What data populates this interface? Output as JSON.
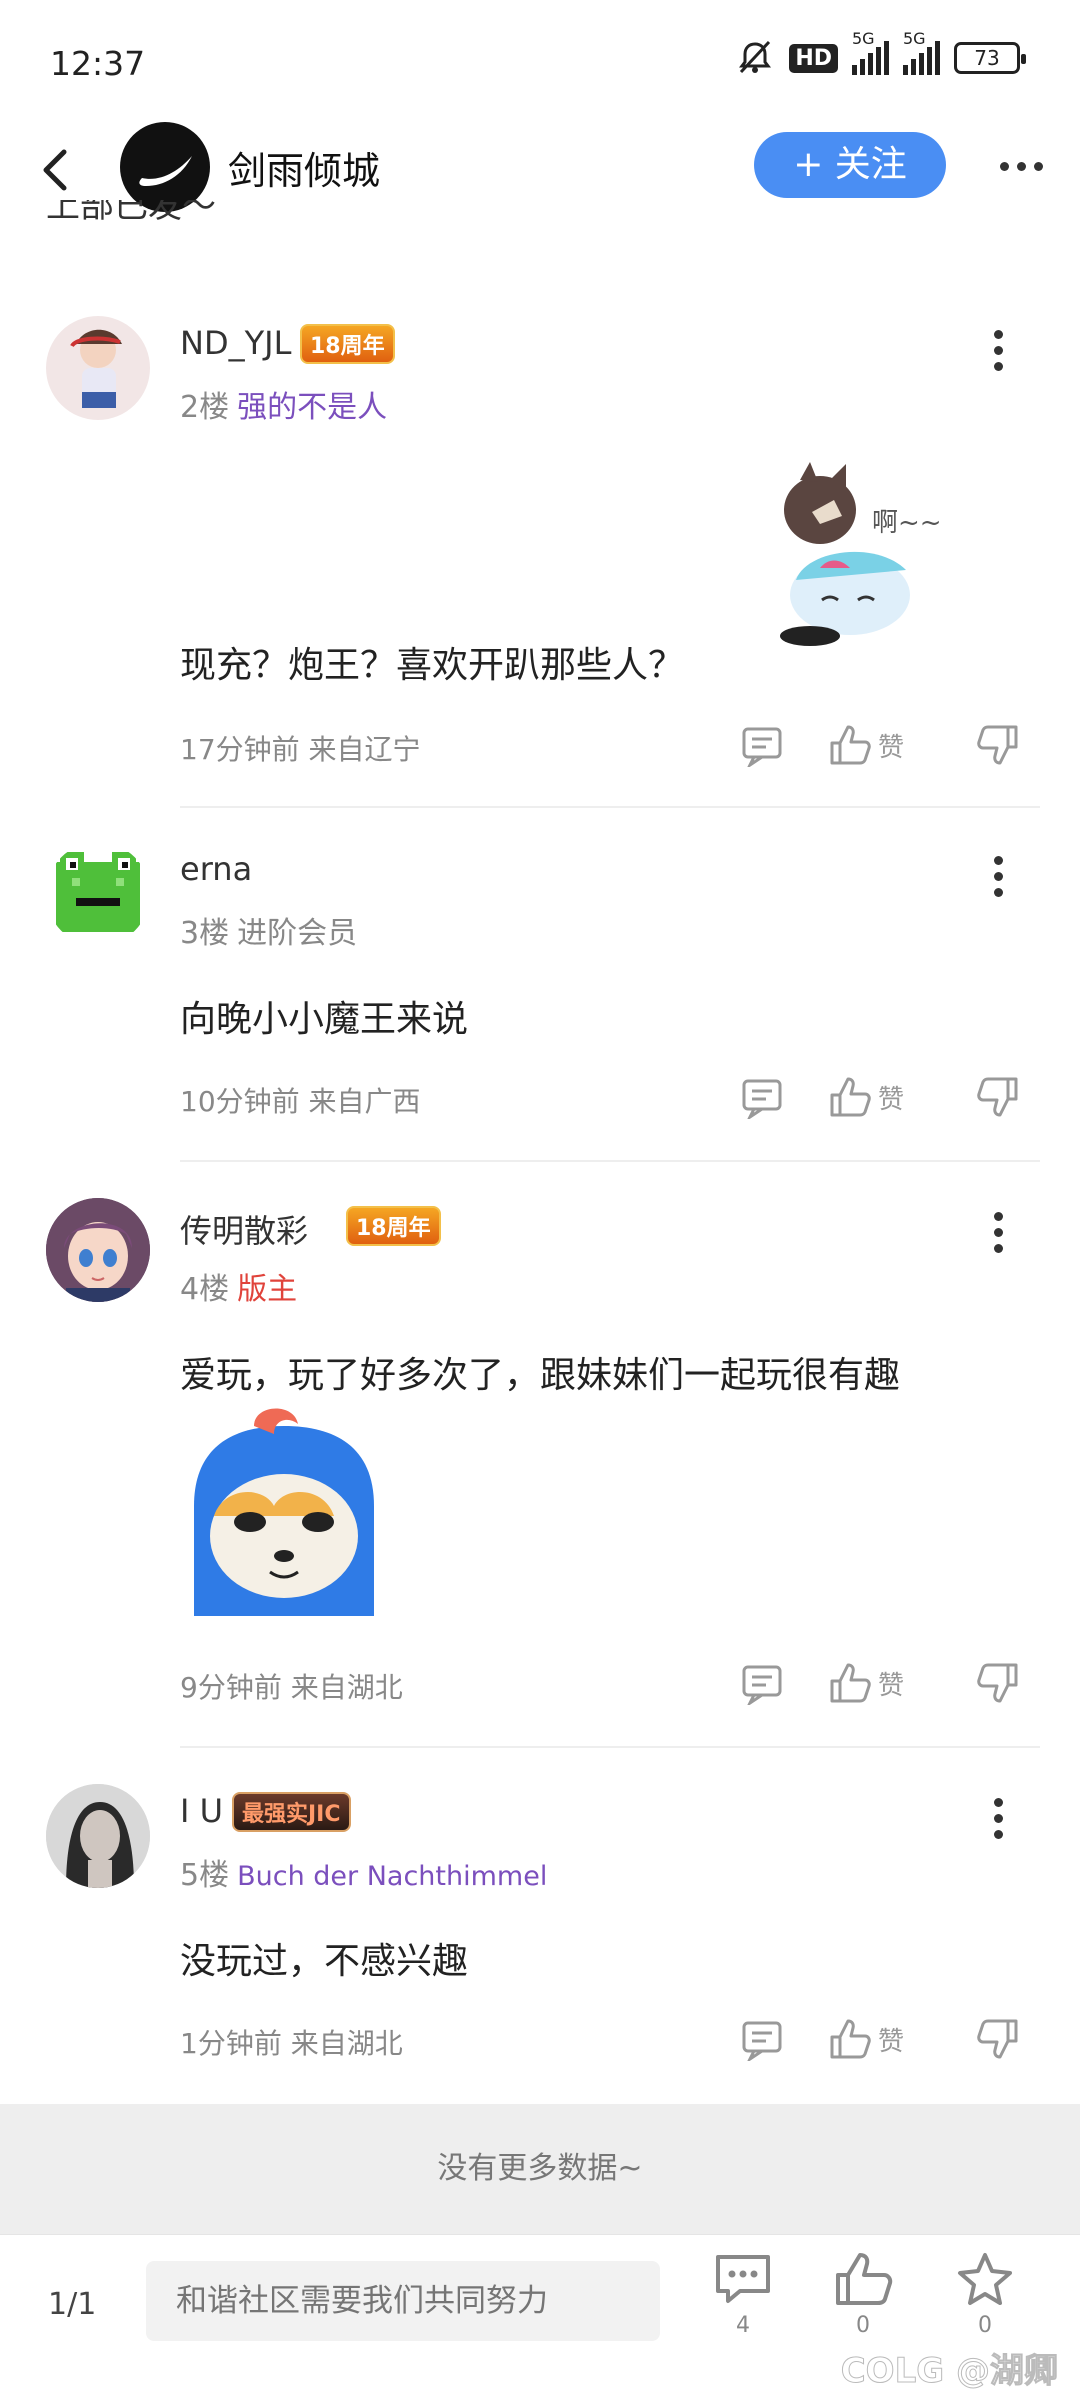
{
  "status": {
    "time": "12:37",
    "network1": "5G",
    "network2": "5G",
    "battery": "73",
    "hd": "HD"
  },
  "header": {
    "title": "剑雨倾城",
    "follow_label": "+ 关注",
    "cut_text": "上部已发～"
  },
  "comments": [
    {
      "user": "ND_YJL",
      "badge": "18周年",
      "floor": "2楼",
      "role": "强的不是人",
      "role_color": "#7b4fbd",
      "text": "现充？炮王？喜欢开趴那些人？",
      "time": "17分钟前 来自辽宁",
      "sticker_text": "啊~~",
      "like": "赞"
    },
    {
      "user": "erna",
      "badge": "",
      "floor": "3楼",
      "role": "进阶会员",
      "role_color": "#888888",
      "text": "向晚小小魔王来说",
      "time": "10分钟前 来自广西",
      "like": "赞"
    },
    {
      "user": "传明散彩",
      "badge": "18周年",
      "floor": "4楼",
      "role": "版主",
      "role_color": "#e0433b",
      "text": "爱玩，玩了好多次了，跟妹妹们一起玩很有趣",
      "time": "9分钟前 来自湖北",
      "like": "赞"
    },
    {
      "user": "I U",
      "badge": "最强实JIC",
      "floor": "5楼",
      "role": "Buch der Nachthimmel",
      "role_color": "#7b4fbd",
      "text": "没玩过，不感兴趣",
      "time": "1分钟前 来自湖北",
      "like": "赞"
    }
  ],
  "footer": {
    "no_more": "没有更多数据~",
    "page": "1/1",
    "placeholder": "和谐社区需要我们共同努力",
    "comments_count": "4",
    "likes_count": "0",
    "stars_count": "0",
    "watermark": "COLG @湖卿"
  },
  "colors": {
    "accent": "#4a8ef3",
    "badge": "#f08a24"
  }
}
